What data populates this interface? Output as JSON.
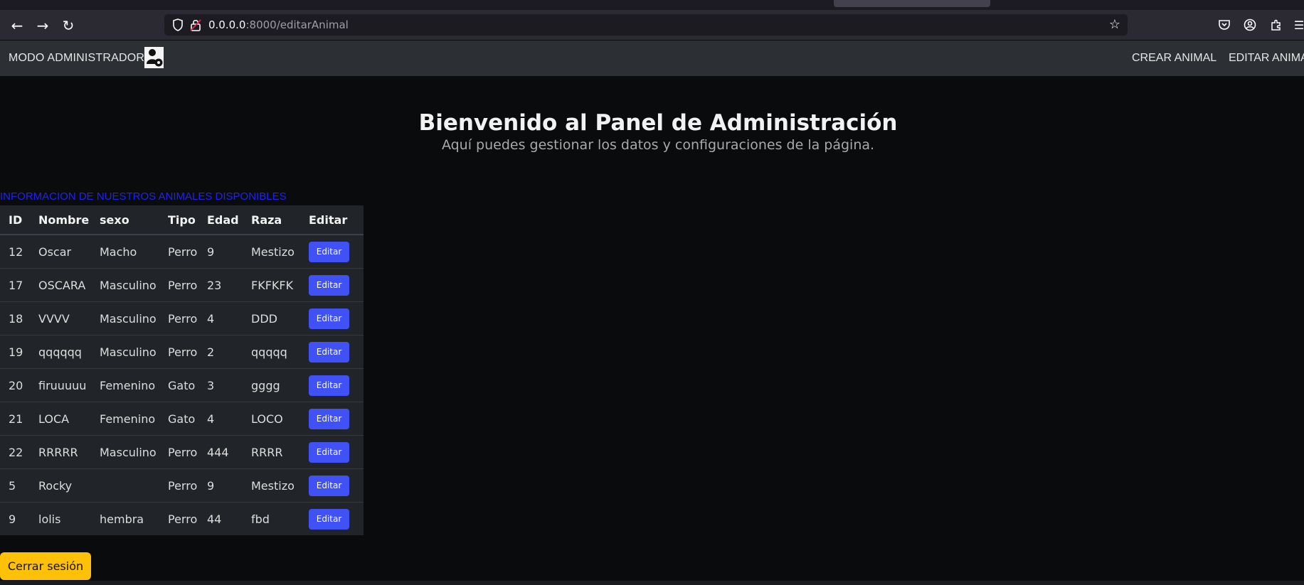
{
  "browser": {
    "url_host": "0.0.0.0",
    "url_path": ":8000/editarAnimal"
  },
  "navbar": {
    "brand": "MODO ADMINISTRADOR",
    "links": [
      "CREAR ANIMAL",
      "EDITAR ANIMA"
    ]
  },
  "hero": {
    "title": "Bienvenido al Panel de Administración",
    "subtitle": "Aquí puedes gestionar los datos y configuraciones de la página."
  },
  "table": {
    "caption": "INFORMACION DE NUESTROS ANIMALES DISPONIBLES",
    "headers": [
      "ID",
      "Nombre",
      "sexo",
      "Tipo",
      "Edad",
      "Raza",
      "Editar"
    ],
    "rows": [
      {
        "id": "12",
        "nombre": "Oscar",
        "sexo": "Macho",
        "tipo": "Perro",
        "edad": "9",
        "raza": "Mestizo",
        "action": "Editar"
      },
      {
        "id": "17",
        "nombre": "OSCARA",
        "sexo": "Masculino",
        "tipo": "Perro",
        "edad": "23",
        "raza": "FKFKFK",
        "action": "Editar"
      },
      {
        "id": "18",
        "nombre": "VVVV",
        "sexo": "Masculino",
        "tipo": "Perro",
        "edad": "4",
        "raza": "DDD",
        "action": "Editar"
      },
      {
        "id": "19",
        "nombre": "qqqqqq",
        "sexo": "Masculino",
        "tipo": "Perro",
        "edad": "2",
        "raza": "qqqqq",
        "action": "Editar"
      },
      {
        "id": "20",
        "nombre": "firuuuuu",
        "sexo": "Femenino",
        "tipo": "Gato",
        "edad": "3",
        "raza": "gggg",
        "action": "Editar"
      },
      {
        "id": "21",
        "nombre": "LOCA",
        "sexo": "Femenino",
        "tipo": "Gato",
        "edad": "4",
        "raza": "LOCO",
        "action": "Editar"
      },
      {
        "id": "22",
        "nombre": "RRRRR",
        "sexo": "Masculino",
        "tipo": "Perro",
        "edad": "444",
        "raza": "RRRR",
        "action": "Editar"
      },
      {
        "id": "5",
        "nombre": "Rocky",
        "sexo": "",
        "tipo": "Perro",
        "edad": "9",
        "raza": "Mestizo",
        "action": "Editar"
      },
      {
        "id": "9",
        "nombre": "lolis",
        "sexo": "hembra",
        "tipo": "Perro",
        "edad": "44",
        "raza": "fbd",
        "action": "Editar"
      }
    ]
  },
  "logout_label": "Cerrar sesión",
  "colors": {
    "accent_button": "#4051f5",
    "logout_button": "#ffc107",
    "caption_text": "#2020ff"
  }
}
